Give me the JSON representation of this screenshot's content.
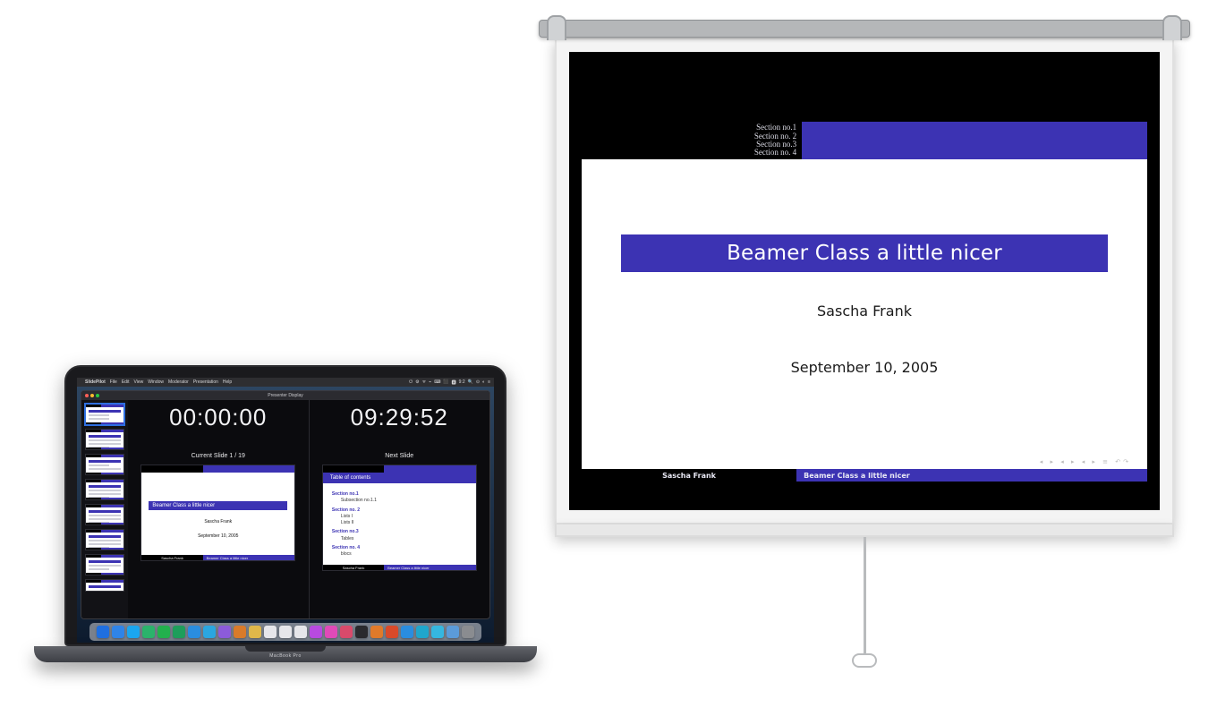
{
  "projector": {
    "head_sections": [
      "Section no.1",
      "Section no. 2",
      "Section no.3",
      "Section no. 4"
    ],
    "title": "Beamer Class a little nicer",
    "author": "Sascha Frank",
    "date": "September 10, 2005",
    "nav_glyphs": "◂ ▸ ◂ ▸ ◂ ▸   ≡   ↶↷",
    "foot_left": "Sascha Frank",
    "foot_right": "Beamer Class a little nicer"
  },
  "mac": {
    "menubar": {
      "app": "SlidePilot",
      "items": [
        "File",
        "Edit",
        "View",
        "Window",
        "Moderator",
        "Presentation",
        "Help"
      ],
      "right": [
        "⏻",
        "⚙",
        "ᯤ",
        "⌁",
        "⌨",
        "⬛",
        "🅰",
        "9:2",
        "🔍",
        "⊙",
        "◐",
        "≡"
      ]
    },
    "window_title": "Presenter Display",
    "timer_left": "00:00:00",
    "timer_right": "09:29:52",
    "current_label": "Current Slide 1 / 19",
    "next_label": "Next Slide",
    "current_slide": {
      "title": "Beamer Class a little nicer",
      "author": "Sascha Frank",
      "date": "September 10, 2005",
      "foot_left": "Sascha Frank",
      "foot_right": "Beamer Class a little nicer"
    },
    "next_slide": {
      "title": "Table of contents",
      "sections": [
        {
          "name": "Section no.1",
          "subs": [
            "Subsection no.1.1"
          ]
        },
        {
          "name": "Section no. 2",
          "subs": [
            "Lists I",
            "Lists II"
          ]
        },
        {
          "name": "Section no.3",
          "subs": [
            "Tables"
          ]
        },
        {
          "name": "Section no. 4",
          "subs": [
            "blocs"
          ]
        }
      ],
      "foot_left": "Sascha Frank",
      "foot_right": "Beamer Class a little nicer"
    },
    "brand": "MacBook Pro",
    "dock_colors": [
      "#1f6fe0",
      "#2f84e8",
      "#1aa6f0",
      "#2bb36b",
      "#23b14d",
      "#1e9e5b",
      "#2a8de0",
      "#2aa6e0",
      "#8c5bd9",
      "#d97b2a",
      "#e0b84a",
      "#e6e6ea",
      "#e6e6ea",
      "#e6e6ea",
      "#b84ae0",
      "#e04ab8",
      "#d94a6b",
      "#2a2a2e",
      "#e07a2a",
      "#d94a2a",
      "#2a8de0",
      "#1fa6cc",
      "#35b7e0",
      "#5b9bd9",
      "#8a8c90"
    ]
  }
}
